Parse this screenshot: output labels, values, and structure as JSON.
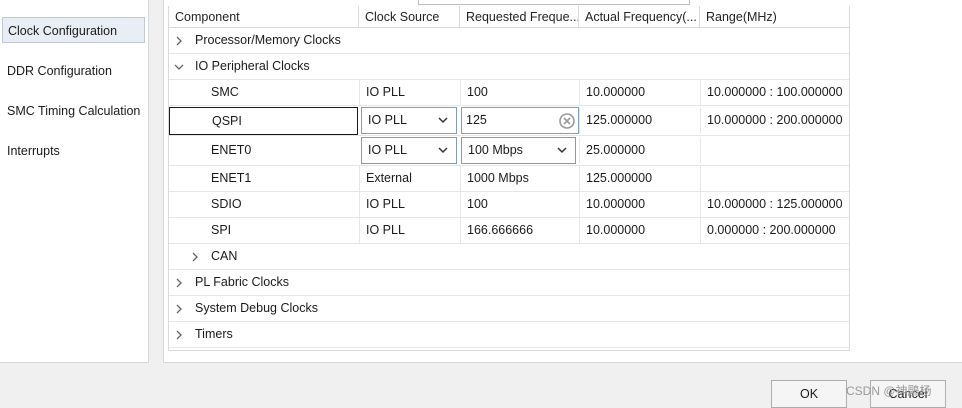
{
  "nav": {
    "items": [
      {
        "label": "Clock Configuration",
        "selected": true
      },
      {
        "label": "DDR Configuration",
        "selected": false
      },
      {
        "label": "SMC Timing Calculation",
        "selected": false
      },
      {
        "label": "Interrupts",
        "selected": false
      }
    ]
  },
  "table": {
    "columns": [
      "Component",
      "Clock Source",
      "Requested Freque...",
      "Actual Frequency(...",
      "Range(MHz)"
    ],
    "rows": [
      {
        "component": "Processor/Memory Clocks",
        "expanded": false
      },
      {
        "component": "IO Peripheral Clocks",
        "expanded": true
      },
      {
        "component": "SMC",
        "source": "IO PLL",
        "requested": "100",
        "actual": "10.000000",
        "range": "10.000000 : 100.000000"
      },
      {
        "component": "QSPI",
        "source": "IO PLL",
        "requested": "125",
        "actual": "125.000000",
        "range": "10.000000 : 200.000000"
      },
      {
        "component": "ENET0",
        "source": "IO PLL",
        "requested": "100 Mbps",
        "actual": "25.000000",
        "range": ""
      },
      {
        "component": "ENET1",
        "source": "External",
        "requested": "1000 Mbps",
        "actual": "125.000000",
        "range": ""
      },
      {
        "component": "SDIO",
        "source": "IO PLL",
        "requested": "100",
        "actual": "10.000000",
        "range": "10.000000 : 125.000000"
      },
      {
        "component": "SPI",
        "source": "IO PLL",
        "requested": "166.666666",
        "actual": "10.000000",
        "range": "0.000000 : 200.000000"
      },
      {
        "component": "CAN",
        "expanded": false
      },
      {
        "component": "PL Fabric Clocks",
        "expanded": false
      },
      {
        "component": "System Debug Clocks",
        "expanded": false
      },
      {
        "component": "Timers",
        "expanded": false
      }
    ]
  },
  "footer": {
    "ok_label": "OK",
    "cancel_label": "Cancel",
    "watermark": "CSDN @神鵰杨"
  },
  "colors": {
    "selected_bg": "#e9eef6",
    "input_border": "#7f9db9",
    "clear_icon": "#9a9a9a"
  }
}
